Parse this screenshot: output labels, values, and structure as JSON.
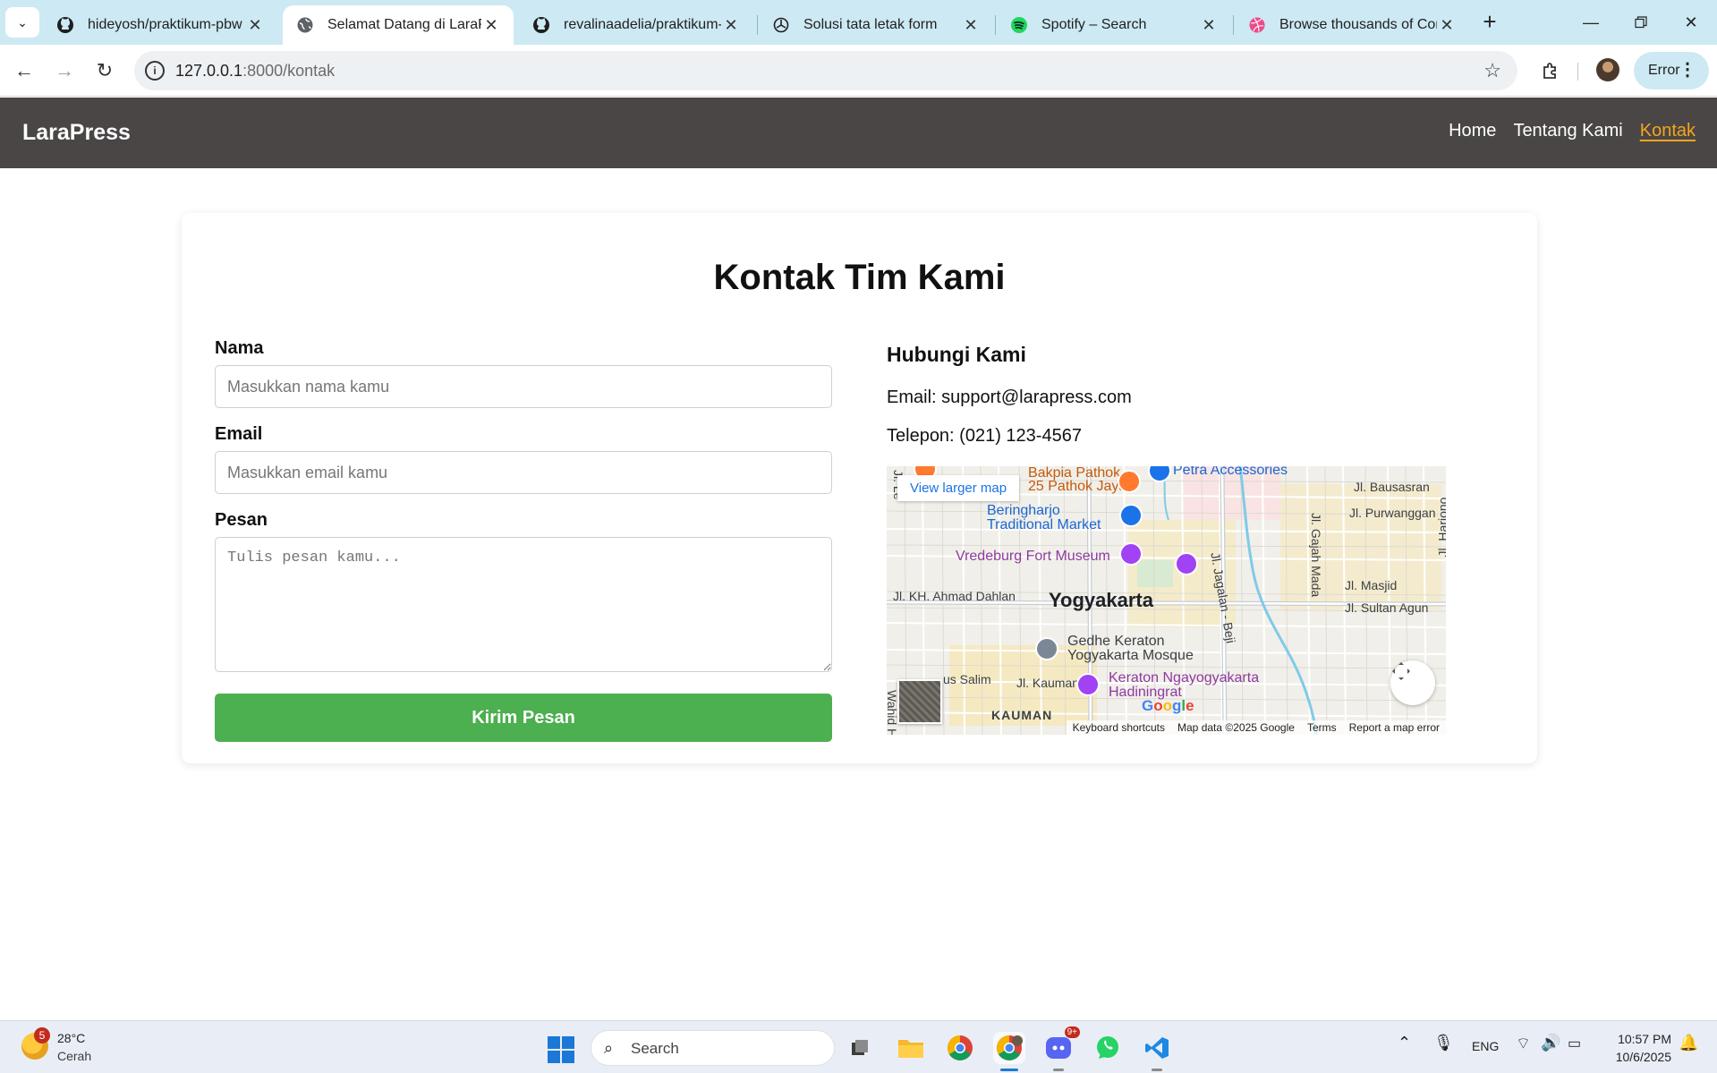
{
  "browser": {
    "tabs": [
      {
        "title": "hideyosh/praktikum-pbw",
        "icon": "github-icon"
      },
      {
        "title": "Selamat Datang di LaraPress",
        "icon": "globe-icon"
      },
      {
        "title": "revalinaadelia/praktikum-la",
        "icon": "github-icon"
      },
      {
        "title": "Solusi tata letak form",
        "icon": "openai-icon"
      },
      {
        "title": "Spotify – Search",
        "icon": "spotify-icon"
      },
      {
        "title": "Browse thousands of Cont",
        "icon": "dribbble-icon"
      }
    ],
    "url_host": "127.0.0.1",
    "url_rest": ":8000/kontak",
    "profile_button": "Error"
  },
  "site": {
    "brand": "LaraPress",
    "nav": [
      {
        "label": "Home",
        "active": false
      },
      {
        "label": "Tentang Kami",
        "active": false
      },
      {
        "label": "Kontak",
        "active": true
      }
    ]
  },
  "contact": {
    "title": "Kontak Tim Kami",
    "form": {
      "name_label": "Nama",
      "name_placeholder": "Masukkan nama kamu",
      "email_label": "Email",
      "email_placeholder": "Masukkan email kamu",
      "message_label": "Pesan",
      "message_placeholder": "Tulis pesan kamu...",
      "submit_label": "Kirim Pesan"
    },
    "info": {
      "heading": "Hubungi Kami",
      "email_line": "Email: support@larapress.com",
      "phone_line": "Telepon: (021) 123-4567"
    },
    "map": {
      "larger_map_link": "View larger map",
      "city": "Yogyakarta",
      "places": {
        "bakpia": "Bakpia Pathok",
        "pathok_jaya": "25 Pathok Jaya",
        "petra": "Petra Accessories",
        "beringharjo_1": "Beringharjo",
        "beringharjo_2": "Traditional Market",
        "vredeburg": "Vredeburg Fort Museum",
        "gedhe_1": "Gedhe Keraton",
        "gedhe_2": "Yogyakarta Mosque",
        "keraton_1": "Keraton Ngayogyakarta",
        "keraton_2": "Hadiningrat",
        "kauman": "KAUMAN"
      },
      "streets": {
        "bausasran": "Jl. Bausasran",
        "purwanggan": "Jl. Purwanggan",
        "masjid": "Jl. Masjid",
        "sultan": "Jl. Sultan Agun",
        "ahmad_dahlan": "Jl. KH. Ahmad Dahlan",
        "agus_salim": "us Salim",
        "kauman_st": "Jl. Kauman",
        "jagalan": "Jl. Jagalan - Beji",
        "gajah_mada": "Jl. Gajah Mada",
        "harjono": "Jl. Harjono",
        "hasyim": "Wahid Hasyim",
        "le": "Jl. Le"
      },
      "logo": "Google",
      "attribution": [
        "Keyboard shortcuts",
        "Map data ©2025 Google",
        "Terms",
        "Report a map error"
      ],
      "colors": {
        "water": "#7ecbe8",
        "road": "#ffffff",
        "block": "#f6e7b8"
      }
    }
  },
  "taskbar": {
    "weather_badge": "5",
    "temperature": "28°C",
    "condition": "Cerah",
    "search_label": "Search",
    "discord_badge": "9+",
    "language": "ENG",
    "time": "10:57 PM",
    "date": "10/6/2025"
  }
}
